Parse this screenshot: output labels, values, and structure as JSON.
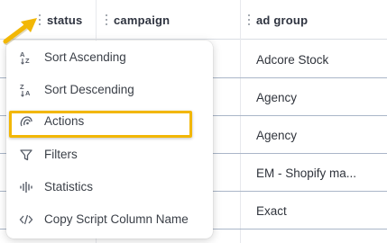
{
  "table": {
    "columns": [
      {
        "key": "status",
        "label": "status"
      },
      {
        "key": "campaign",
        "label": "campaign"
      },
      {
        "key": "ad_group",
        "label": "ad group"
      }
    ],
    "rows": [
      {
        "campaign_fragment": "..",
        "ad_group": "Adcore Stock"
      },
      {
        "campaign_fragment": "",
        "ad_group": "Agency"
      },
      {
        "campaign_fragment": "",
        "ad_group": "Agency"
      },
      {
        "campaign_fragment": "",
        "ad_group": "EM - Shopify ma..."
      },
      {
        "campaign_fragment": "..",
        "ad_group": "Exact"
      }
    ]
  },
  "column_menu": {
    "items": [
      {
        "label": "Sort Ascending",
        "icon": "sort-ascending-icon"
      },
      {
        "label": "Sort Descending",
        "icon": "sort-descending-icon"
      },
      {
        "label": "Actions",
        "icon": "actions-icon",
        "highlighted": true
      },
      {
        "label": "Filters",
        "icon": "filter-icon"
      },
      {
        "label": "Statistics",
        "icon": "statistics-icon"
      },
      {
        "label": "Copy Script Column Name",
        "icon": "code-icon"
      }
    ]
  },
  "colors": {
    "highlight": "#f2b705",
    "arrow": "#f2b705",
    "row_border": "#aab6c8"
  }
}
